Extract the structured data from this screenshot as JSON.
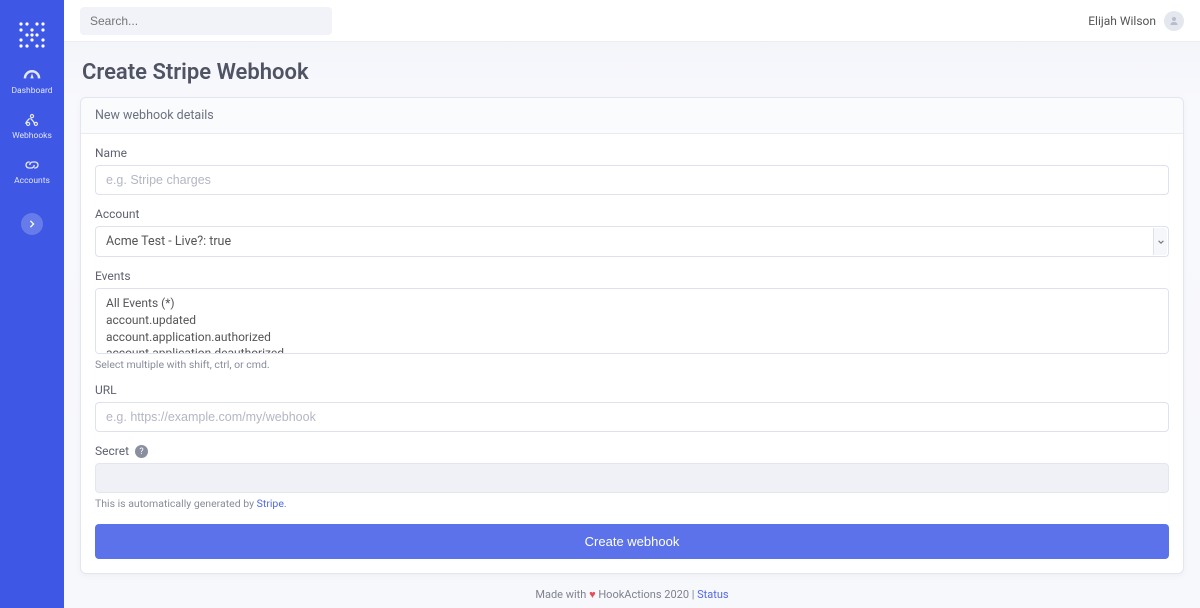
{
  "sidebar": {
    "items": [
      {
        "label": "Dashboard"
      },
      {
        "label": "Webhooks"
      },
      {
        "label": "Accounts"
      }
    ]
  },
  "topbar": {
    "search_placeholder": "Search...",
    "user_name": "Elijah Wilson"
  },
  "page": {
    "title": "Create Stripe Webhook"
  },
  "card": {
    "header": "New webhook details"
  },
  "form": {
    "name_label": "Name",
    "name_placeholder": "e.g. Stripe charges",
    "account_label": "Account",
    "account_selected": "Acme Test - Live?: true",
    "events_label": "Events",
    "events_help": "Select multiple with shift, ctrl, or cmd.",
    "events_options": [
      "All Events (*)",
      "account.updated",
      "account.application.authorized",
      "account.application.deauthorized"
    ],
    "url_label": "URL",
    "url_placeholder": "e.g. https://example.com/my/webhook",
    "secret_label": "Secret",
    "secret_help_prefix": "This is automatically generated by ",
    "secret_help_link": "Stripe",
    "secret_help_suffix": ".",
    "submit_label": "Create webhook"
  },
  "footer": {
    "prefix": "Made with ",
    "mid": " HookActions 2020 | ",
    "status": "Status"
  }
}
